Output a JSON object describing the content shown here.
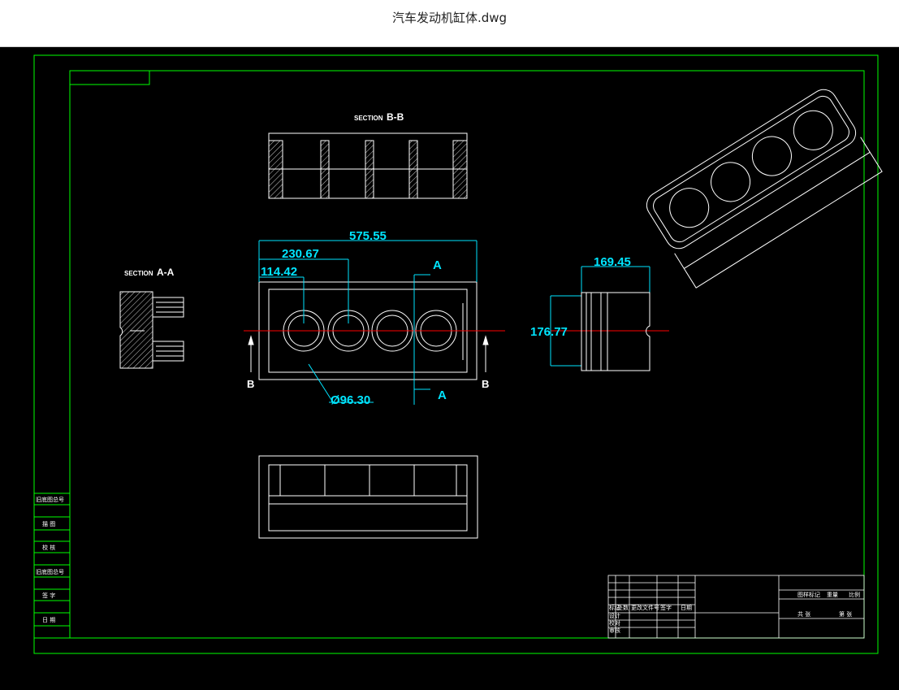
{
  "window": {
    "title": "汽车发动机缸体.dwg"
  },
  "drawing": {
    "section_bb": {
      "prefix": "SECTION",
      "name": "B-B"
    },
    "section_aa": {
      "prefix": "SECTION",
      "name": "A-A"
    },
    "dimensions": {
      "overall_length": "575.55",
      "bore_pitch_2": "230.67",
      "bore_pitch_1": "114.42",
      "bore_diameter": "Ø96.30",
      "side_width": "169.45",
      "side_height": "176.77"
    },
    "cut_labels": {
      "a_top": "A",
      "a_bottom": "A",
      "b_left": "B",
      "b_right": "B"
    },
    "left_strip": [
      "旧底图总号",
      "描 图",
      "校 核",
      "旧底图总号",
      "签 字",
      "日 期"
    ],
    "title_block": {
      "left_cells": [
        "标记",
        "处数",
        "更改文件号",
        "签字",
        "日期",
        "设计",
        "校对",
        "审核"
      ],
      "right_cells": [
        "图样标记",
        "重量",
        "比例",
        "共 张",
        "第 张"
      ]
    },
    "colors": {
      "border": "#00ff00",
      "lines": "#ffffff",
      "dimension": "#00e5ff",
      "centerline": "#ff0000"
    }
  }
}
